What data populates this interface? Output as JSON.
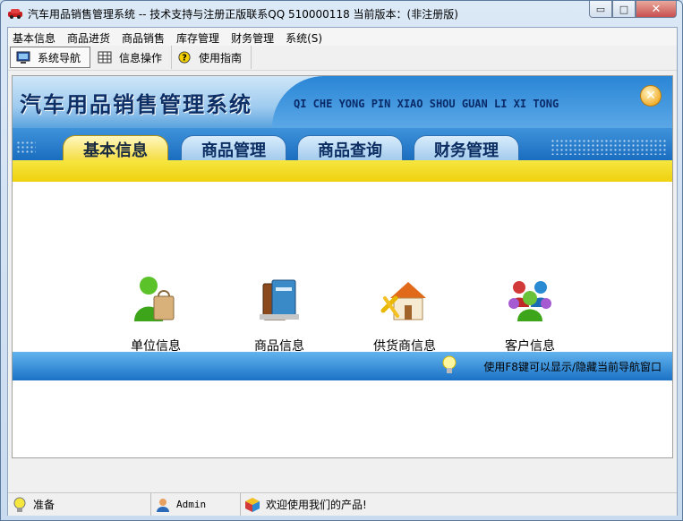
{
  "window": {
    "title": "汽车用品销售管理系统 -- 技术支持与注册正版联系QQ 510000118   当前版本：(非注册版)"
  },
  "menu": [
    "基本信息",
    "商品进货",
    "商品销售",
    "库存管理",
    "财务管理",
    "系统(S)"
  ],
  "toolbar": {
    "nav_label": "系统导航",
    "info_label": "信息操作",
    "guide_label": "使用指南"
  },
  "banner": {
    "brand": "汽车用品销售管理系统",
    "pinyin": "QI CHE YONG PIN XIAO SHOU GUAN LI XI TONG"
  },
  "tabs": [
    "基本信息",
    "商品管理",
    "商品查询",
    "财务管理"
  ],
  "icons": [
    {
      "label": "单位信息",
      "icon": "person-bag-icon"
    },
    {
      "label": "商品信息",
      "icon": "books-icon"
    },
    {
      "label": "供货商信息",
      "icon": "house-tools-icon"
    },
    {
      "label": "客户信息",
      "icon": "group-people-icon"
    }
  ],
  "hint": "使用F8键可以显示/隐藏当前导航窗口",
  "status": {
    "ready": "准备",
    "user": "Admin",
    "welcome": "欢迎使用我们的产品!"
  },
  "colors": {
    "banner_blue": "#1d78c8",
    "tab_active": "#f4dc3a",
    "yellow_band": "#efd10e"
  }
}
